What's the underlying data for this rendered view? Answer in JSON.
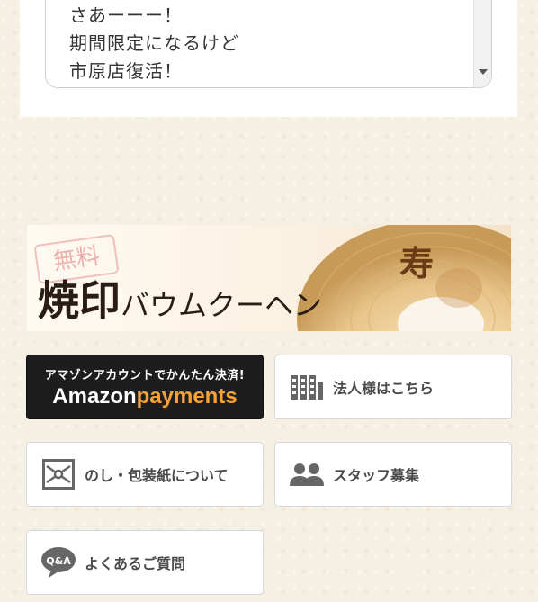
{
  "message_box": {
    "lines": [
      "さあーーー！",
      "期間限定になるけど",
      "市原店復活！"
    ]
  },
  "banner": {
    "stamp": "無料",
    "title_main": "焼印",
    "title_sub": "バウムクーヘン",
    "brand_mark": "寿"
  },
  "buttons": {
    "amazon": {
      "top": "アマゾンアカウントでかんたん決済!",
      "brand": "Amazon",
      "pay": "payments"
    },
    "corporate": {
      "label": "法人様はこちら",
      "icon": "building-icon"
    },
    "noshi": {
      "label": "のし・包装紙について",
      "icon": "gift-wrap-icon"
    },
    "staff": {
      "label": "スタッフ募集",
      "icon": "people-icon"
    },
    "faq": {
      "label": "よくあるご質問",
      "icon": "qa-bubble-icon"
    }
  },
  "colors": {
    "amazon_orange": "#f3a23a",
    "amazon_black": "#1d1d1d"
  }
}
